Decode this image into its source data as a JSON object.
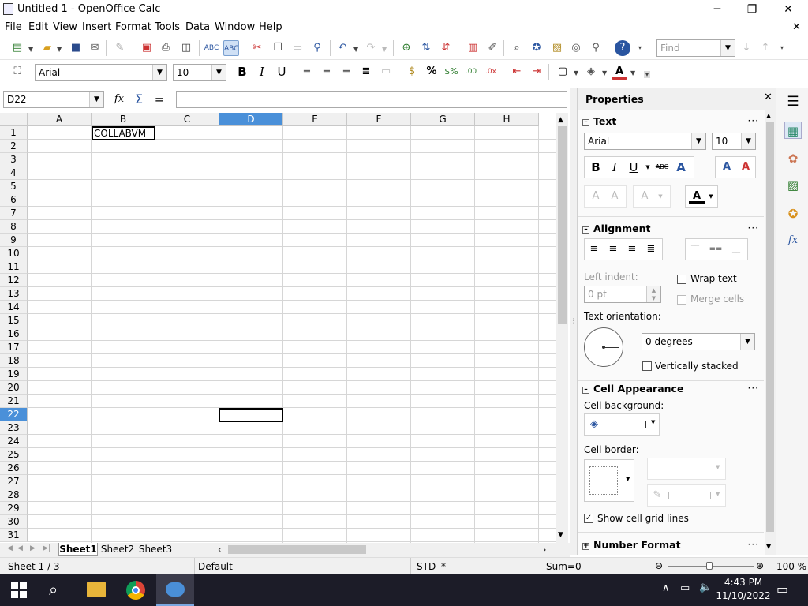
{
  "window": {
    "title": "Untitled 1 - OpenOffice Calc",
    "minimize": "─",
    "maximize": "❐",
    "close": "✕",
    "doc_close": "✕"
  },
  "menu": [
    "File",
    "Edit",
    "View",
    "Insert",
    "Format",
    "Tools",
    "Data",
    "Window",
    "Help"
  ],
  "toolbar": {
    "find_placeholder": "Find"
  },
  "format_bar": {
    "font_name": "Arial",
    "font_size": "10"
  },
  "formula_bar": {
    "name_box": "D22",
    "value": ""
  },
  "grid": {
    "columns": [
      "A",
      "B",
      "C",
      "D",
      "E",
      "F",
      "G",
      "H"
    ],
    "selected_column": "D",
    "rows": [
      "1",
      "2",
      "3",
      "4",
      "5",
      "6",
      "7",
      "8",
      "9",
      "10",
      "11",
      "12",
      "13",
      "14",
      "15",
      "16",
      "17",
      "18",
      "19",
      "20",
      "21",
      "22",
      "23",
      "24",
      "25",
      "26",
      "27",
      "28",
      "29",
      "30",
      "31"
    ],
    "selected_row": "22",
    "cells": {
      "B1": "COLLABVM"
    },
    "active_cell": "D22"
  },
  "sheets": [
    "Sheet1",
    "Sheet2",
    "Sheet3"
  ],
  "active_sheet": "Sheet1",
  "status": {
    "sheet": "Sheet 1 / 3",
    "style": "Default",
    "mode": "STD",
    "modified": "*",
    "sum": "Sum=0",
    "zoom": "100 %"
  },
  "sidebar": {
    "title": "Properties",
    "text_section": {
      "title": "Text",
      "font_name": "Arial",
      "font_size": "10"
    },
    "alignment": {
      "title": "Alignment",
      "left_indent_label": "Left indent:",
      "left_indent_value": "0 pt",
      "wrap_text": "Wrap text",
      "merge_cells": "Merge cells",
      "text_orientation": "Text orientation:",
      "orientation_value": "0 degrees",
      "vertically_stacked": "Vertically stacked"
    },
    "cell_appearance": {
      "title": "Cell Appearance",
      "background_label": "Cell background:",
      "border_label": "Cell border:",
      "show_grid": "Show cell grid lines",
      "show_grid_checked": true
    },
    "number_format": {
      "title": "Number Format"
    }
  },
  "taskbar": {
    "time": "4:43 PM",
    "date": "11/10/2022"
  }
}
